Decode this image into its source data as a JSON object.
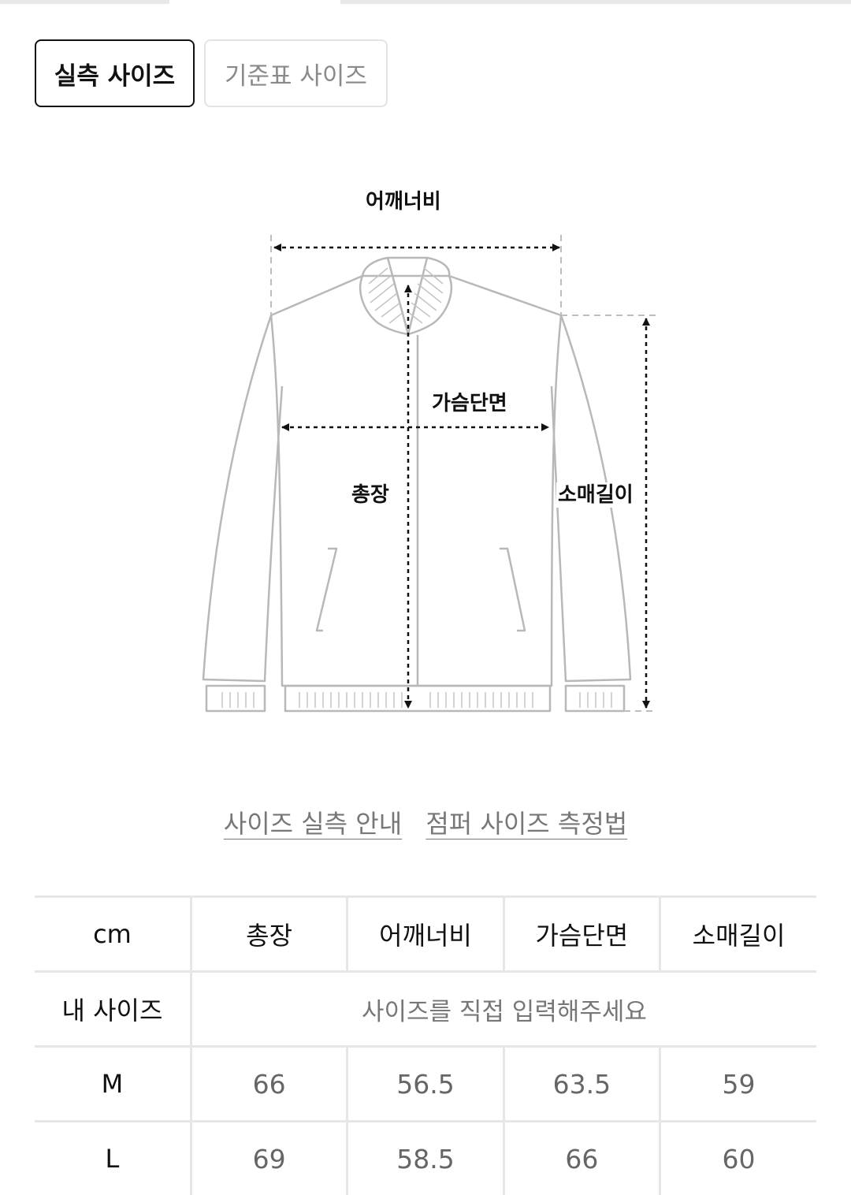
{
  "tabs": {
    "actual": "실측 사이즈",
    "standard": "기준표 사이즈"
  },
  "diagram": {
    "shoulder": "어깨너비",
    "chest": "가슴단면",
    "length": "총장",
    "sleeve": "소매길이"
  },
  "links": {
    "guide": "사이즈 실측 안내",
    "howto": "점퍼 사이즈 측정법"
  },
  "table": {
    "unit": "cm",
    "headers": [
      "총장",
      "어깨너비",
      "가슴단면",
      "소매길이"
    ],
    "my_size_label": "내 사이즈",
    "my_size_prompt": "사이즈를 직접 입력해주세요",
    "rows": [
      {
        "size": "M",
        "values": [
          "66",
          "56.5",
          "63.5",
          "59"
        ]
      },
      {
        "size": "L",
        "values": [
          "69",
          "58.5",
          "66",
          "60"
        ]
      }
    ]
  }
}
